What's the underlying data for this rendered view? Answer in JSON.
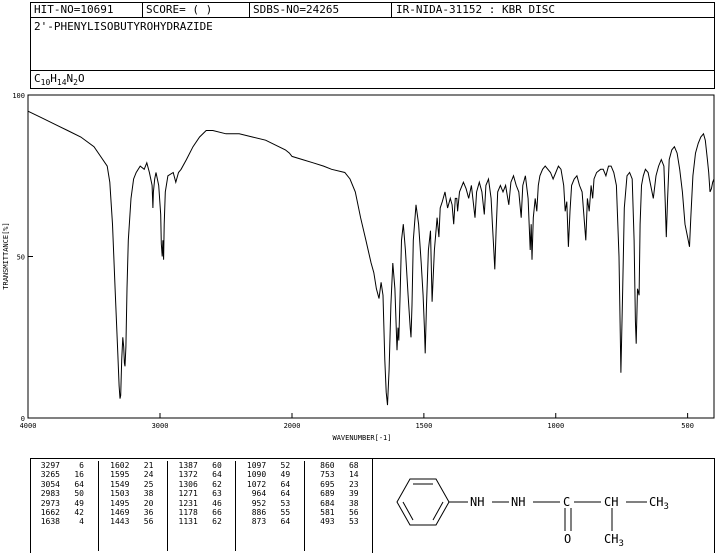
{
  "header": {
    "hit_no": "HIT-NO=10691",
    "score": "SCORE=  (   )",
    "sdbs_no": "SDBS-NO=24265",
    "ir_id": "IR-NIDA-31152 : KBR DISC",
    "compound_name": "2'-PHENYLISOBUTYROHYDRAZIDE",
    "formula": {
      "c": "C",
      "c_n": "10",
      "h": "H",
      "h_n": "14",
      "n": "N",
      "n_n": "2",
      "o": "O"
    }
  },
  "chart_data": {
    "type": "line",
    "title": "",
    "xlabel": "WAVENUMBER[-1]",
    "ylabel": "TRANSMITTANCE[%]",
    "xlim": [
      4000,
      400
    ],
    "ylim": [
      0,
      100
    ],
    "x_ticks": [
      "4000",
      "3000",
      "2000",
      "1500",
      "1000",
      "500"
    ],
    "y_ticks": [
      "100",
      "50",
      "0"
    ],
    "x_breakpoint": 2000,
    "series": [
      {
        "points": [
          [
            4000,
            95
          ],
          [
            3900,
            93
          ],
          [
            3800,
            91
          ],
          [
            3700,
            89
          ],
          [
            3600,
            87
          ],
          [
            3500,
            84
          ],
          [
            3450,
            81
          ],
          [
            3400,
            78
          ],
          [
            3380,
            73
          ],
          [
            3360,
            60
          ],
          [
            3340,
            40
          ],
          [
            3320,
            20
          ],
          [
            3310,
            10
          ],
          [
            3303,
            6
          ],
          [
            3298,
            7
          ],
          [
            3290,
            18
          ],
          [
            3282,
            25
          ],
          [
            3275,
            22
          ],
          [
            3270,
            17
          ],
          [
            3265,
            16
          ],
          [
            3258,
            22
          ],
          [
            3250,
            40
          ],
          [
            3240,
            55
          ],
          [
            3220,
            68
          ],
          [
            3200,
            74
          ],
          [
            3180,
            76
          ],
          [
            3150,
            78
          ],
          [
            3120,
            77
          ],
          [
            3100,
            79
          ],
          [
            3080,
            76
          ],
          [
            3060,
            72
          ],
          [
            3054,
            65
          ],
          [
            3050,
            70
          ],
          [
            3040,
            74
          ],
          [
            3030,
            76
          ],
          [
            3010,
            72
          ],
          [
            2995,
            63
          ],
          [
            2990,
            54
          ],
          [
            2985,
            51
          ],
          [
            2983,
            50
          ],
          [
            2978,
            55
          ],
          [
            2973,
            49
          ],
          [
            2968,
            60
          ],
          [
            2960,
            70
          ],
          [
            2940,
            75
          ],
          [
            2900,
            76
          ],
          [
            2880,
            73
          ],
          [
            2860,
            76
          ],
          [
            2840,
            77
          ],
          [
            2800,
            80
          ],
          [
            2750,
            84
          ],
          [
            2700,
            87
          ],
          [
            2650,
            89
          ],
          [
            2600,
            89
          ],
          [
            2500,
            88
          ],
          [
            2400,
            88
          ],
          [
            2300,
            87
          ],
          [
            2200,
            86
          ],
          [
            2100,
            84
          ],
          [
            2050,
            83
          ],
          [
            2020,
            82
          ],
          [
            2000,
            81
          ],
          [
            1960,
            80
          ],
          [
            1920,
            79
          ],
          [
            1880,
            78
          ],
          [
            1850,
            77
          ],
          [
            1800,
            76
          ],
          [
            1780,
            74
          ],
          [
            1760,
            70
          ],
          [
            1740,
            62
          ],
          [
            1720,
            55
          ],
          [
            1700,
            48
          ],
          [
            1690,
            45
          ],
          [
            1680,
            40
          ],
          [
            1670,
            37
          ],
          [
            1662,
            42
          ],
          [
            1655,
            38
          ],
          [
            1648,
            18
          ],
          [
            1643,
            8
          ],
          [
            1638,
            4
          ],
          [
            1632,
            15
          ],
          [
            1625,
            35
          ],
          [
            1618,
            48
          ],
          [
            1610,
            40
          ],
          [
            1602,
            21
          ],
          [
            1598,
            28
          ],
          [
            1595,
            24
          ],
          [
            1590,
            38
          ],
          [
            1585,
            55
          ],
          [
            1578,
            60
          ],
          [
            1570,
            52
          ],
          [
            1560,
            38
          ],
          [
            1552,
            28
          ],
          [
            1549,
            25
          ],
          [
            1545,
            35
          ],
          [
            1540,
            55
          ],
          [
            1530,
            66
          ],
          [
            1520,
            60
          ],
          [
            1510,
            48
          ],
          [
            1503,
            38
          ],
          [
            1498,
            28
          ],
          [
            1495,
            20
          ],
          [
            1490,
            35
          ],
          [
            1483,
            52
          ],
          [
            1475,
            58
          ],
          [
            1469,
            36
          ],
          [
            1460,
            52
          ],
          [
            1450,
            62
          ],
          [
            1443,
            56
          ],
          [
            1438,
            65
          ],
          [
            1430,
            67
          ],
          [
            1420,
            70
          ],
          [
            1410,
            65
          ],
          [
            1400,
            68
          ],
          [
            1393,
            66
          ],
          [
            1387,
            60
          ],
          [
            1381,
            68
          ],
          [
            1375,
            68
          ],
          [
            1372,
            64
          ],
          [
            1365,
            70
          ],
          [
            1350,
            73
          ],
          [
            1340,
            71
          ],
          [
            1330,
            68
          ],
          [
            1320,
            72
          ],
          [
            1306,
            62
          ],
          [
            1300,
            70
          ],
          [
            1290,
            73
          ],
          [
            1280,
            70
          ],
          [
            1271,
            63
          ],
          [
            1265,
            72
          ],
          [
            1255,
            74
          ],
          [
            1245,
            68
          ],
          [
            1240,
            60
          ],
          [
            1235,
            52
          ],
          [
            1231,
            46
          ],
          [
            1226,
            58
          ],
          [
            1220,
            70
          ],
          [
            1210,
            72
          ],
          [
            1200,
            70
          ],
          [
            1190,
            72
          ],
          [
            1178,
            66
          ],
          [
            1170,
            73
          ],
          [
            1160,
            75
          ],
          [
            1150,
            72
          ],
          [
            1140,
            70
          ],
          [
            1131,
            62
          ],
          [
            1125,
            72
          ],
          [
            1115,
            75
          ],
          [
            1105,
            68
          ],
          [
            1097,
            52
          ],
          [
            1093,
            60
          ],
          [
            1090,
            49
          ],
          [
            1085,
            62
          ],
          [
            1078,
            68
          ],
          [
            1072,
            64
          ],
          [
            1066,
            72
          ],
          [
            1060,
            75
          ],
          [
            1050,
            77
          ],
          [
            1040,
            78
          ],
          [
            1020,
            76
          ],
          [
            1010,
            74
          ],
          [
            1000,
            76
          ],
          [
            990,
            78
          ],
          [
            980,
            77
          ],
          [
            970,
            72
          ],
          [
            964,
            64
          ],
          [
            958,
            67
          ],
          [
            952,
            53
          ],
          [
            946,
            64
          ],
          [
            940,
            72
          ],
          [
            930,
            74
          ],
          [
            920,
            75
          ],
          [
            910,
            72
          ],
          [
            900,
            70
          ],
          [
            886,
            55
          ],
          [
            880,
            68
          ],
          [
            873,
            64
          ],
          [
            866,
            72
          ],
          [
            860,
            68
          ],
          [
            855,
            74
          ],
          [
            845,
            76
          ],
          [
            830,
            77
          ],
          [
            820,
            77
          ],
          [
            810,
            75
          ],
          [
            800,
            78
          ],
          [
            790,
            78
          ],
          [
            780,
            76
          ],
          [
            770,
            72
          ],
          [
            760,
            50
          ],
          [
            753,
            14
          ],
          [
            746,
            40
          ],
          [
            740,
            65
          ],
          [
            730,
            75
          ],
          [
            720,
            76
          ],
          [
            710,
            74
          ],
          [
            703,
            55
          ],
          [
            698,
            30
          ],
          [
            695,
            23
          ],
          [
            690,
            40
          ],
          [
            684,
            38
          ],
          [
            680,
            60
          ],
          [
            675,
            72
          ],
          [
            668,
            75
          ],
          [
            660,
            77
          ],
          [
            650,
            76
          ],
          [
            640,
            72
          ],
          [
            630,
            68
          ],
          [
            620,
            75
          ],
          [
            610,
            78
          ],
          [
            600,
            80
          ],
          [
            590,
            78
          ],
          [
            585,
            67
          ],
          [
            581,
            56
          ],
          [
            576,
            68
          ],
          [
            570,
            80
          ],
          [
            560,
            83
          ],
          [
            550,
            84
          ],
          [
            540,
            82
          ],
          [
            530,
            77
          ],
          [
            520,
            70
          ],
          [
            510,
            60
          ],
          [
            500,
            56
          ],
          [
            493,
            53
          ],
          [
            488,
            62
          ],
          [
            480,
            75
          ],
          [
            470,
            82
          ],
          [
            460,
            85
          ],
          [
            450,
            87
          ],
          [
            440,
            88
          ],
          [
            433,
            86
          ],
          [
            425,
            80
          ],
          [
            420,
            76
          ],
          [
            415,
            70
          ],
          [
            410,
            71
          ],
          [
            405,
            73
          ],
          [
            400,
            74
          ]
        ]
      }
    ]
  },
  "peak_table": {
    "columns": [
      [
        [
          "3297",
          "6"
        ],
        [
          "3265",
          "16"
        ],
        [
          "3054",
          "64"
        ],
        [
          "2983",
          "50"
        ],
        [
          "2973",
          "49"
        ],
        [
          "1662",
          "42"
        ],
        [
          "1638",
          "4"
        ]
      ],
      [
        [
          "1602",
          "21"
        ],
        [
          "1595",
          "24"
        ],
        [
          "1549",
          "25"
        ],
        [
          "1503",
          "38"
        ],
        [
          "1495",
          "20"
        ],
        [
          "1469",
          "36"
        ],
        [
          "1443",
          "56"
        ]
      ],
      [
        [
          "1387",
          "60"
        ],
        [
          "1372",
          "64"
        ],
        [
          "1306",
          "62"
        ],
        [
          "1271",
          "63"
        ],
        [
          "1231",
          "46"
        ],
        [
          "1178",
          "66"
        ],
        [
          "1131",
          "62"
        ]
      ],
      [
        [
          "1097",
          "52"
        ],
        [
          "1090",
          "49"
        ],
        [
          "1072",
          "64"
        ],
        [
          "964",
          "64"
        ],
        [
          "952",
          "53"
        ],
        [
          "886",
          "55"
        ],
        [
          "873",
          "64"
        ]
      ],
      [
        [
          "860",
          "68"
        ],
        [
          "753",
          "14"
        ],
        [
          "695",
          "23"
        ],
        [
          "689",
          "39"
        ],
        [
          "684",
          "38"
        ],
        [
          "581",
          "56"
        ],
        [
          "493",
          "53"
        ]
      ]
    ]
  },
  "structure": {
    "nh1": "NH",
    "nh2": "NH",
    "c": "C",
    "ch": "CH",
    "ch3_top": "CH",
    "ch3_top_sub": "3",
    "o": "O",
    "ch3_bottom": "CH",
    "ch3_bottom_sub": "3"
  }
}
